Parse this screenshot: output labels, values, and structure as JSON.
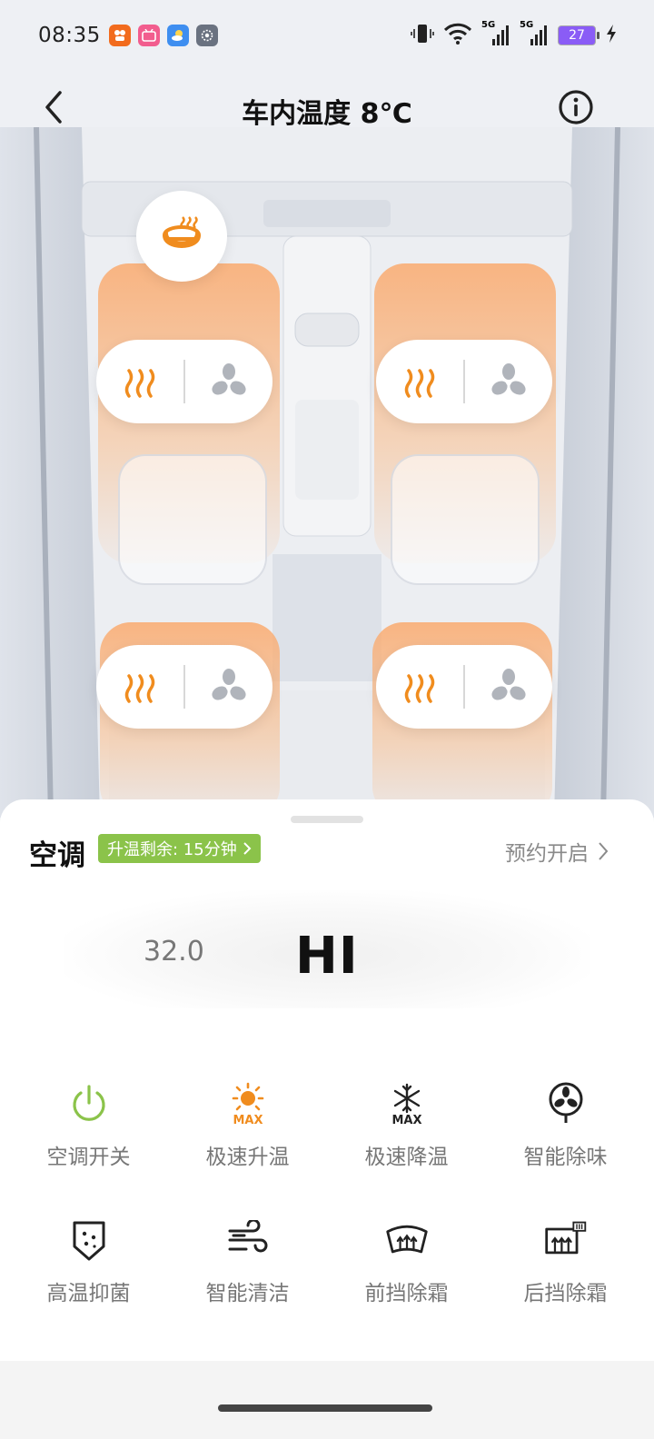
{
  "status_bar": {
    "time": "08:35",
    "battery": "27",
    "network_1": "5G",
    "network_2": "5G"
  },
  "header": {
    "title": "车内温度 8℃"
  },
  "ac": {
    "title": "空调",
    "timer_badge": "升温剩余: 15分钟",
    "schedule_label": "预约开启",
    "temp_previous": "32.0",
    "temp_current": "HI"
  },
  "functions": [
    {
      "label": "空调开关",
      "icon": "power-icon"
    },
    {
      "label": "极速升温",
      "icon": "max-heat-icon"
    },
    {
      "label": "极速降温",
      "icon": "max-cool-icon"
    },
    {
      "label": "智能除味",
      "icon": "fan-deodorize-icon"
    },
    {
      "label": "高温抑菌",
      "icon": "sterilize-icon"
    },
    {
      "label": "智能清洁",
      "icon": "clean-wind-icon"
    },
    {
      "label": "前挡除霜",
      "icon": "front-defrost-icon"
    },
    {
      "label": "后挡除霜",
      "icon": "rear-defrost-icon"
    }
  ],
  "colors": {
    "heat_orange": "#f08c1e",
    "power_green": "#8bc34a",
    "badge_green": "#8bc34a"
  }
}
